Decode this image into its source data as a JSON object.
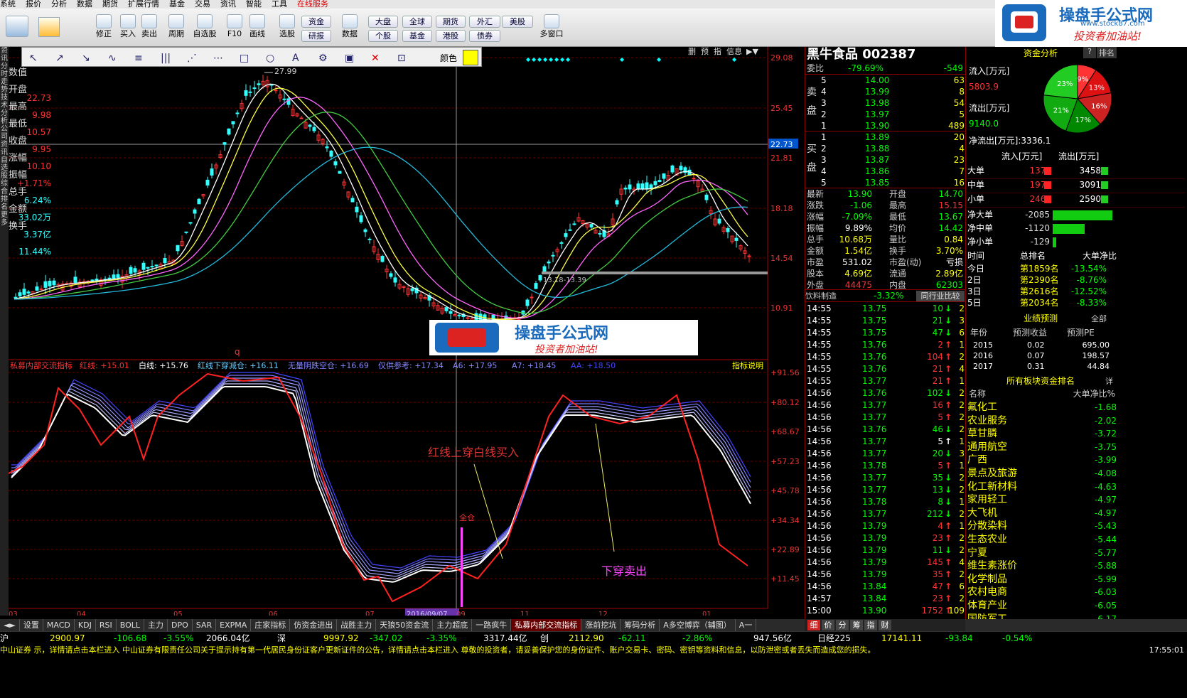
{
  "menu": [
    "系统",
    "报价",
    "分析",
    "数据",
    "期货",
    "扩展行情",
    "基金",
    "交易",
    "资讯",
    "智能",
    "工具",
    "在线服务"
  ],
  "toolbar": {
    "left_buttons": [
      {
        "label": "修正"
      },
      {
        "label": "买入"
      },
      {
        "label": "卖出"
      },
      {
        "label": "周期"
      },
      {
        "label": "自选股"
      },
      {
        "label": "F10"
      },
      {
        "label": "画线"
      },
      {
        "label": "选股"
      },
      {
        "label": "数据"
      }
    ],
    "pills": [
      "资金",
      "研报",
      "大盘",
      "个股",
      "全球",
      "基金",
      "期货",
      "港股",
      "外汇",
      "债券",
      "美股"
    ],
    "multiwin": "多窗口"
  },
  "logo": {
    "title": "操盘手公式网",
    "url": "www.stock87.com",
    "slogan": "投资者加油站!"
  },
  "drawbar": {
    "color_label": "颜色",
    "color": "#ffff00"
  },
  "left_strip": "资讯 分时走势 技术分析 公司资讯 自选股 综合排名 更多",
  "chart": {
    "ohlc_panel": [
      {
        "k": "数值",
        "v": ""
      },
      {
        "k": "开盘",
        "v": "22.73"
      },
      {
        "k": "最高",
        "v": "9.98"
      },
      {
        "k": "最低",
        "v": "10.57"
      },
      {
        "k": "收盘",
        "v": "9.95"
      },
      {
        "k": "涨幅",
        "v": "10.10"
      },
      {
        "k": "振幅",
        "v": "+1.71%"
      },
      {
        "k": "总手",
        "v": "6.24%"
      },
      {
        "k": "金额",
        "v": "33.02万"
      },
      {
        "k": "换手",
        "v": "3.37亿"
      },
      {
        "k": "",
        "v": "11.44%"
      }
    ],
    "price_axis": [
      "29.08",
      "25.45",
      "22.73",
      "21.81",
      "18.18",
      "14.54",
      "10.91"
    ],
    "ind_axis": [
      "+91.56",
      "+80.12",
      "+68.67",
      "+57.23",
      "+45.78",
      "+34.34",
      "+22.89",
      "+11.45"
    ],
    "date_axis": [
      "03",
      "04",
      "05",
      "06",
      "07",
      "2016/09/07",
      "09",
      "11",
      "12",
      "01"
    ],
    "high_label": "27.99",
    "support_label": "13.18-13.39",
    "top_btns": [
      "删",
      "预",
      "指",
      "信息"
    ],
    "indicator_title": "私募内部交流指标",
    "indicator_params": [
      {
        "k": "红线:",
        "v": "+15.01",
        "c": "#ff3333"
      },
      {
        "k": "白线:",
        "v": "+15.76",
        "c": "#ffffff"
      },
      {
        "k": "红线下穿减仓:",
        "v": "+16.11",
        "c": "#66ccff"
      },
      {
        "k": "无量阴跌空仓:",
        "v": "+16.69",
        "c": "#8888ff"
      },
      {
        "k": "仅供参考:",
        "v": "+17.34",
        "c": "#8888ff"
      },
      {
        "k": "A6:",
        "v": "+17.95",
        "c": "#8888ff"
      },
      {
        "k": "A7:",
        "v": "+18.45",
        "c": "#8888ff"
      },
      {
        "k": "AA:",
        "v": "+18.50",
        "c": "#4444ff"
      }
    ],
    "indicator_help": "指标说明",
    "annot_buy": "红线上穿白线买入",
    "annot_sell": "下穿卖出",
    "annot_full": "全仓",
    "marker_q": "q"
  },
  "quote": {
    "name": "黑牛食品 002387",
    "weibi_label": "委比",
    "weibi": "-79.69%",
    "weicha": "-549",
    "sell": [
      [
        "5",
        "14.00",
        "63"
      ],
      [
        "4",
        "13.99",
        "8"
      ],
      [
        "3",
        "13.98",
        "54"
      ],
      [
        "2",
        "13.97",
        "5"
      ],
      [
        "1",
        "13.90",
        "489"
      ]
    ],
    "buy": [
      [
        "1",
        "13.89",
        "20"
      ],
      [
        "2",
        "13.88",
        "4"
      ],
      [
        "3",
        "13.87",
        "23"
      ],
      [
        "4",
        "13.86",
        "7"
      ],
      [
        "5",
        "13.85",
        "16"
      ]
    ],
    "sell_side": "卖盘",
    "buy_side": "买盘",
    "stats": [
      [
        "最新",
        "13.90",
        "开盘",
        "14.70"
      ],
      [
        "涨跌",
        "-1.06",
        "最高",
        "15.15"
      ],
      [
        "涨幅",
        "-7.09%",
        "最低",
        "13.67"
      ],
      [
        "振幅",
        "9.89%",
        "均价",
        "14.42"
      ],
      [
        "总手",
        "10.68万",
        "量比",
        "0.84"
      ],
      [
        "金额",
        "1.54亿",
        "换手",
        "3.70%"
      ],
      [
        "市盈",
        "531.02",
        "市盈(动)",
        "亏损"
      ],
      [
        "股本",
        "4.69亿",
        "流通",
        "2.89亿"
      ],
      [
        "外盘",
        "44475",
        "内盘",
        "62303"
      ]
    ],
    "industry": "饮料制造",
    "industry_pct": "-3.32%",
    "peer_btn": "同行业比较",
    "ticks": [
      [
        "14:55",
        "13.75",
        "10",
        "2"
      ],
      [
        "14:55",
        "13.75",
        "21",
        "3"
      ],
      [
        "14:55",
        "13.75",
        "47",
        "6"
      ],
      [
        "14:55",
        "13.76",
        "2",
        "1"
      ],
      [
        "14:55",
        "13.76",
        "104",
        "2"
      ],
      [
        "14:55",
        "13.76",
        "21",
        "4"
      ],
      [
        "14:55",
        "13.77",
        "21",
        "1"
      ],
      [
        "14:56",
        "13.76",
        "102",
        "2"
      ],
      [
        "14:56",
        "13.77",
        "16",
        "2"
      ],
      [
        "14:56",
        "13.77",
        "5",
        "2"
      ],
      [
        "14:56",
        "13.76",
        "46",
        "2"
      ],
      [
        "14:56",
        "13.77",
        "5",
        "1"
      ],
      [
        "14:56",
        "13.77",
        "20",
        "3"
      ],
      [
        "14:56",
        "13.78",
        "5",
        "1"
      ],
      [
        "14:56",
        "13.77",
        "35",
        "2"
      ],
      [
        "14:56",
        "13.77",
        "13",
        "2"
      ],
      [
        "14:56",
        "13.78",
        "8",
        "1"
      ],
      [
        "14:56",
        "13.77",
        "212",
        "2"
      ],
      [
        "14:56",
        "13.79",
        "4",
        "1"
      ],
      [
        "14:56",
        "13.79",
        "23",
        "2"
      ],
      [
        "14:56",
        "13.79",
        "11",
        "2"
      ],
      [
        "14:56",
        "13.79",
        "145",
        "4"
      ],
      [
        "14:56",
        "13.79",
        "35",
        "2"
      ],
      [
        "14:56",
        "13.84",
        "47",
        "6"
      ],
      [
        "14:57",
        "13.84",
        "23",
        "2"
      ],
      [
        "15:00",
        "13.90",
        "1752",
        "109"
      ]
    ],
    "tick_dirs": [
      "d",
      "d",
      "d",
      "u",
      "u",
      "u",
      "u",
      "d",
      "u",
      "u",
      "d",
      "u",
      "d",
      "u",
      "d",
      "d",
      "d",
      "d",
      "u",
      "u",
      "d",
      "u",
      "u",
      "u",
      "u",
      "u"
    ],
    "tick_colors": [
      "g",
      "g",
      "g",
      "r",
      "r",
      "r",
      "r",
      "g",
      "r",
      "r",
      "g",
      "w",
      "g",
      "r",
      "g",
      "g",
      "g",
      "g",
      "r",
      "r",
      "g",
      "r",
      "r",
      "r",
      "r",
      "r"
    ],
    "bottom_tabs": [
      "细",
      "价",
      "分",
      "筹",
      "指",
      "财"
    ]
  },
  "fund": {
    "title": "资金分析",
    "rank_btn": "排名",
    "in_label": "流入[万元]",
    "in_val": "5803.9",
    "out_label": "流出[万元]",
    "out_val": "9140.0",
    "net": "净流出[万元]:",
    "net_val": "3336.1",
    "pie": [
      {
        "label": "23%",
        "v": 23,
        "c": "#22cc22"
      },
      {
        "label": "21%",
        "v": 21,
        "c": "#11aa11"
      },
      {
        "label": "17%",
        "v": 17,
        "c": "#008800"
      },
      {
        "label": "16%",
        "v": 16,
        "c": "#cc2222"
      },
      {
        "label": "13%",
        "v": 13,
        "c": "#dd1111"
      },
      {
        "label": "9%",
        "v": 9,
        "c": "#ff3333"
      }
    ],
    "hdr": [
      "流入[万元]",
      "流出[万元]"
    ],
    "rows": [
      [
        "大单",
        "1372",
        "3458"
      ],
      [
        "中单",
        "1970",
        "3091"
      ],
      [
        "小单",
        "2460",
        "2590"
      ]
    ],
    "net_rows": [
      [
        "净大单",
        "-2085",
        1.0
      ],
      [
        "净中单",
        "-1120",
        0.54
      ],
      [
        "净小单",
        "-129",
        0.06
      ]
    ],
    "rank_hdr": [
      "时间",
      "总排名",
      "大单净比"
    ],
    "ranks": [
      [
        "今日",
        "第1859名",
        "-13.54%"
      ],
      [
        "2日",
        "第2390名",
        "-8.76%"
      ],
      [
        "3日",
        "第2616名",
        "-12.52%"
      ],
      [
        "5日",
        "第2034名",
        "-8.33%"
      ]
    ],
    "forecast_title": "业绩预测",
    "forecast_all": "全部",
    "forecast_hdr": [
      "年份",
      "预测收益",
      "预测PE"
    ],
    "forecast": [
      [
        "2015",
        "0.02",
        "695.00"
      ],
      [
        "2016",
        "0.07",
        "198.57"
      ],
      [
        "2017",
        "0.31",
        "44.84"
      ]
    ],
    "sector_title": "所有板块资金排名",
    "sector_detail": "详",
    "sector_hdr": [
      "名称",
      "大单净比%"
    ],
    "sectors": [
      [
        "氟化工",
        "-1.68"
      ],
      [
        "农业服务",
        "-2.02"
      ],
      [
        "草甘膦",
        "-3.72"
      ],
      [
        "通用航空",
        "-3.75"
      ],
      [
        "广西",
        "-3.99"
      ],
      [
        "景点及旅游",
        "-4.08"
      ],
      [
        "化工新材料",
        "-4.63"
      ],
      [
        "家用轻工",
        "-4.97"
      ],
      [
        "大飞机",
        "-4.97"
      ],
      [
        "分散染料",
        "-5.43"
      ],
      [
        "生态农业",
        "-5.44"
      ],
      [
        "宁夏",
        "-5.77"
      ],
      [
        "维生素涨价",
        "-5.88"
      ],
      [
        "化学制品",
        "-5.99"
      ],
      [
        "农村电商",
        "-6.03"
      ],
      [
        "体育产业",
        "-6.05"
      ],
      [
        "国防军工",
        "-6.17"
      ]
    ]
  },
  "tabs": [
    "设置",
    "MACD",
    "KDJ",
    "RSI",
    "BOLL",
    "主力",
    "DPO",
    "SAR",
    "EXPMA",
    "庄家指标",
    "仿资金进出",
    "战胜主力",
    "天狼50资金流",
    "主力超底",
    "一路疯牛",
    "私募内部交流指标",
    "涨前挖坑",
    "筹码分析",
    "A多空博弈（辅图）",
    "A一"
  ],
  "index_bar": [
    [
      "沪",
      "",
      "w"
    ],
    [
      "2900.97",
      "",
      "y"
    ],
    [
      "-106.68",
      "",
      "g"
    ],
    [
      "-3.55%",
      "",
      "g"
    ],
    [
      "2066.04亿",
      "",
      "w"
    ],
    [
      "深",
      "",
      "w"
    ],
    [
      "9997.92",
      "",
      "y"
    ],
    [
      "-347.02",
      "",
      "g"
    ],
    [
      "-3.35%",
      "",
      "g"
    ],
    [
      "3317.44亿",
      "",
      "w"
    ],
    [
      "创",
      "",
      "w"
    ],
    [
      "2112.90",
      "",
      "y"
    ],
    [
      "-62.11",
      "",
      "g"
    ],
    [
      "-2.86%",
      "",
      "g"
    ],
    [
      "947.56亿",
      "",
      "w"
    ],
    [
      "日经225",
      "",
      "w"
    ],
    [
      "17141.11",
      "",
      "y"
    ],
    [
      "-93.84",
      "",
      "g"
    ],
    [
      "-0.54%",
      "",
      "g"
    ]
  ],
  "marquee": "中山证券 示，详情请点击本栏进入 中山证券有限责任公司关于提示持有第一代居民身份证客户更新证件的公告，详情请点击本栏进入 尊敬的投资者，请妥善保护您的身份证件、账户交易卡、密码、密钥等资料和信息，以防泄密或者丢失而造成您的损失。",
  "clock": "17:55:01"
}
